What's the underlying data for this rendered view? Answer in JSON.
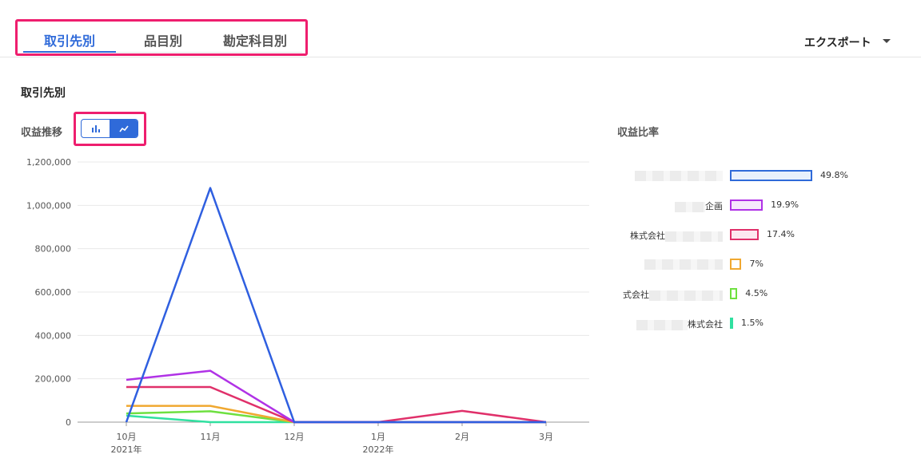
{
  "tabs": [
    {
      "label": "取引先別",
      "active": true
    },
    {
      "label": "品目別",
      "active": false
    },
    {
      "label": "勘定科目別",
      "active": false
    }
  ],
  "export_label": "エクスポート",
  "section_title": "取引先別",
  "trend_title": "収益推移",
  "ratio_title": "収益比率",
  "toggle": {
    "bar_icon": "bar-chart-icon",
    "line_icon": "line-chart-icon",
    "selected": "line"
  },
  "colors": {
    "accent": "#2f6ad9",
    "highlight": "#ee1e6e"
  },
  "chart_data": {
    "type": "line",
    "categories": [
      "10月",
      "11月",
      "12月",
      "1月",
      "2月",
      "3月"
    ],
    "year_labels": [
      "2021年",
      "",
      "",
      "2022年",
      "",
      ""
    ],
    "ylim": [
      0,
      1200000
    ],
    "yticks": [
      "1,200,000",
      "1,000,000",
      "800,000",
      "600,000",
      "400,000",
      "200,000",
      "0"
    ],
    "grid": true,
    "series": [
      {
        "color": "#2f5fe0",
        "values": [
          0,
          1080000,
          0,
          0,
          0,
          0
        ]
      },
      {
        "color": "#b032e6",
        "values": [
          195000,
          237000,
          0,
          0,
          0,
          0
        ]
      },
      {
        "color": "#e0306a",
        "values": [
          162000,
          162000,
          0,
          0,
          52000,
          0
        ]
      },
      {
        "color": "#f0a830",
        "values": [
          75000,
          75000,
          0,
          0,
          0,
          0
        ]
      },
      {
        "color": "#6ee040",
        "values": [
          40000,
          50000,
          0,
          0,
          0,
          0
        ]
      },
      {
        "color": "#30e0a0",
        "values": [
          30000,
          0,
          0,
          0,
          0,
          0
        ]
      }
    ]
  },
  "ratio_data": [
    {
      "label": "",
      "percent": 49.8,
      "pct_text": "49.8%",
      "color": "#2f6ad9",
      "fill": "#e8f0fc"
    },
    {
      "label": "企画",
      "percent": 19.9,
      "pct_text": "19.9%",
      "color": "#b032e6",
      "fill": "#f6e8fc"
    },
    {
      "label": "株式会社",
      "percent": 17.4,
      "pct_text": "17.4%",
      "color": "#e0306a",
      "fill": "#fce8f0"
    },
    {
      "label": "",
      "percent": 7,
      "pct_text": "7%",
      "color": "#f0a830",
      "fill": "#ffffff"
    },
    {
      "label": "式会社",
      "percent": 4.5,
      "pct_text": "4.5%",
      "color": "#6ee040",
      "fill": "#ffffff"
    },
    {
      "label": "株式会社",
      "percent": 1.5,
      "pct_text": "1.5%",
      "color": "#30e0a0",
      "fill": "#ffffff"
    }
  ]
}
